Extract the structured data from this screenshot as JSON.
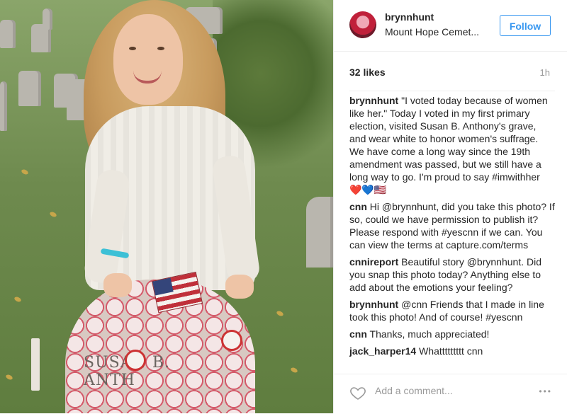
{
  "post": {
    "username": "brynnhunt",
    "location": "Mount Hope Cemet...",
    "follow_label": "Follow",
    "likes": "32 likes",
    "time": "1h",
    "photo_engraving": "SUSAN B. ANTH"
  },
  "comments": [
    {
      "user": "brynnhunt",
      "text": "\"I voted today because of women like her.\" Today I voted in my first primary election, visited Susan B. Anthony's grave, and wear white to honor women's suffrage. We have come a long way since the 19th amendment was passed, but we still have a long way to go. I'm proud to say #imwithher ❤️💙🇺🇸"
    },
    {
      "user": "cnn",
      "text": "Hi @brynnhunt, did you take this photo? If so, could we have permission to publish it? Please respond with #yescnn if we can. You can view the terms at capture.com/terms"
    },
    {
      "user": "cnnireport",
      "text": "Beautiful story @brynnhunt. Did you snap this photo today? Anything else to add about the emotions your feeling?"
    },
    {
      "user": "brynnhunt",
      "text": "@cnn Friends that I made in line took this photo! And of course! #yescnn"
    },
    {
      "user": "cnn",
      "text": "Thanks, much appreciated!"
    },
    {
      "user": "jack_harper14",
      "text": "Whattttttttt cnn"
    }
  ],
  "footer": {
    "add_comment_placeholder": "Add a comment...",
    "more_label": "•••"
  },
  "icons": {
    "like": "heart-icon",
    "more": "more-options-icon"
  },
  "colors": {
    "accent": "#3897f0",
    "text": "#262626",
    "muted": "#999999"
  }
}
